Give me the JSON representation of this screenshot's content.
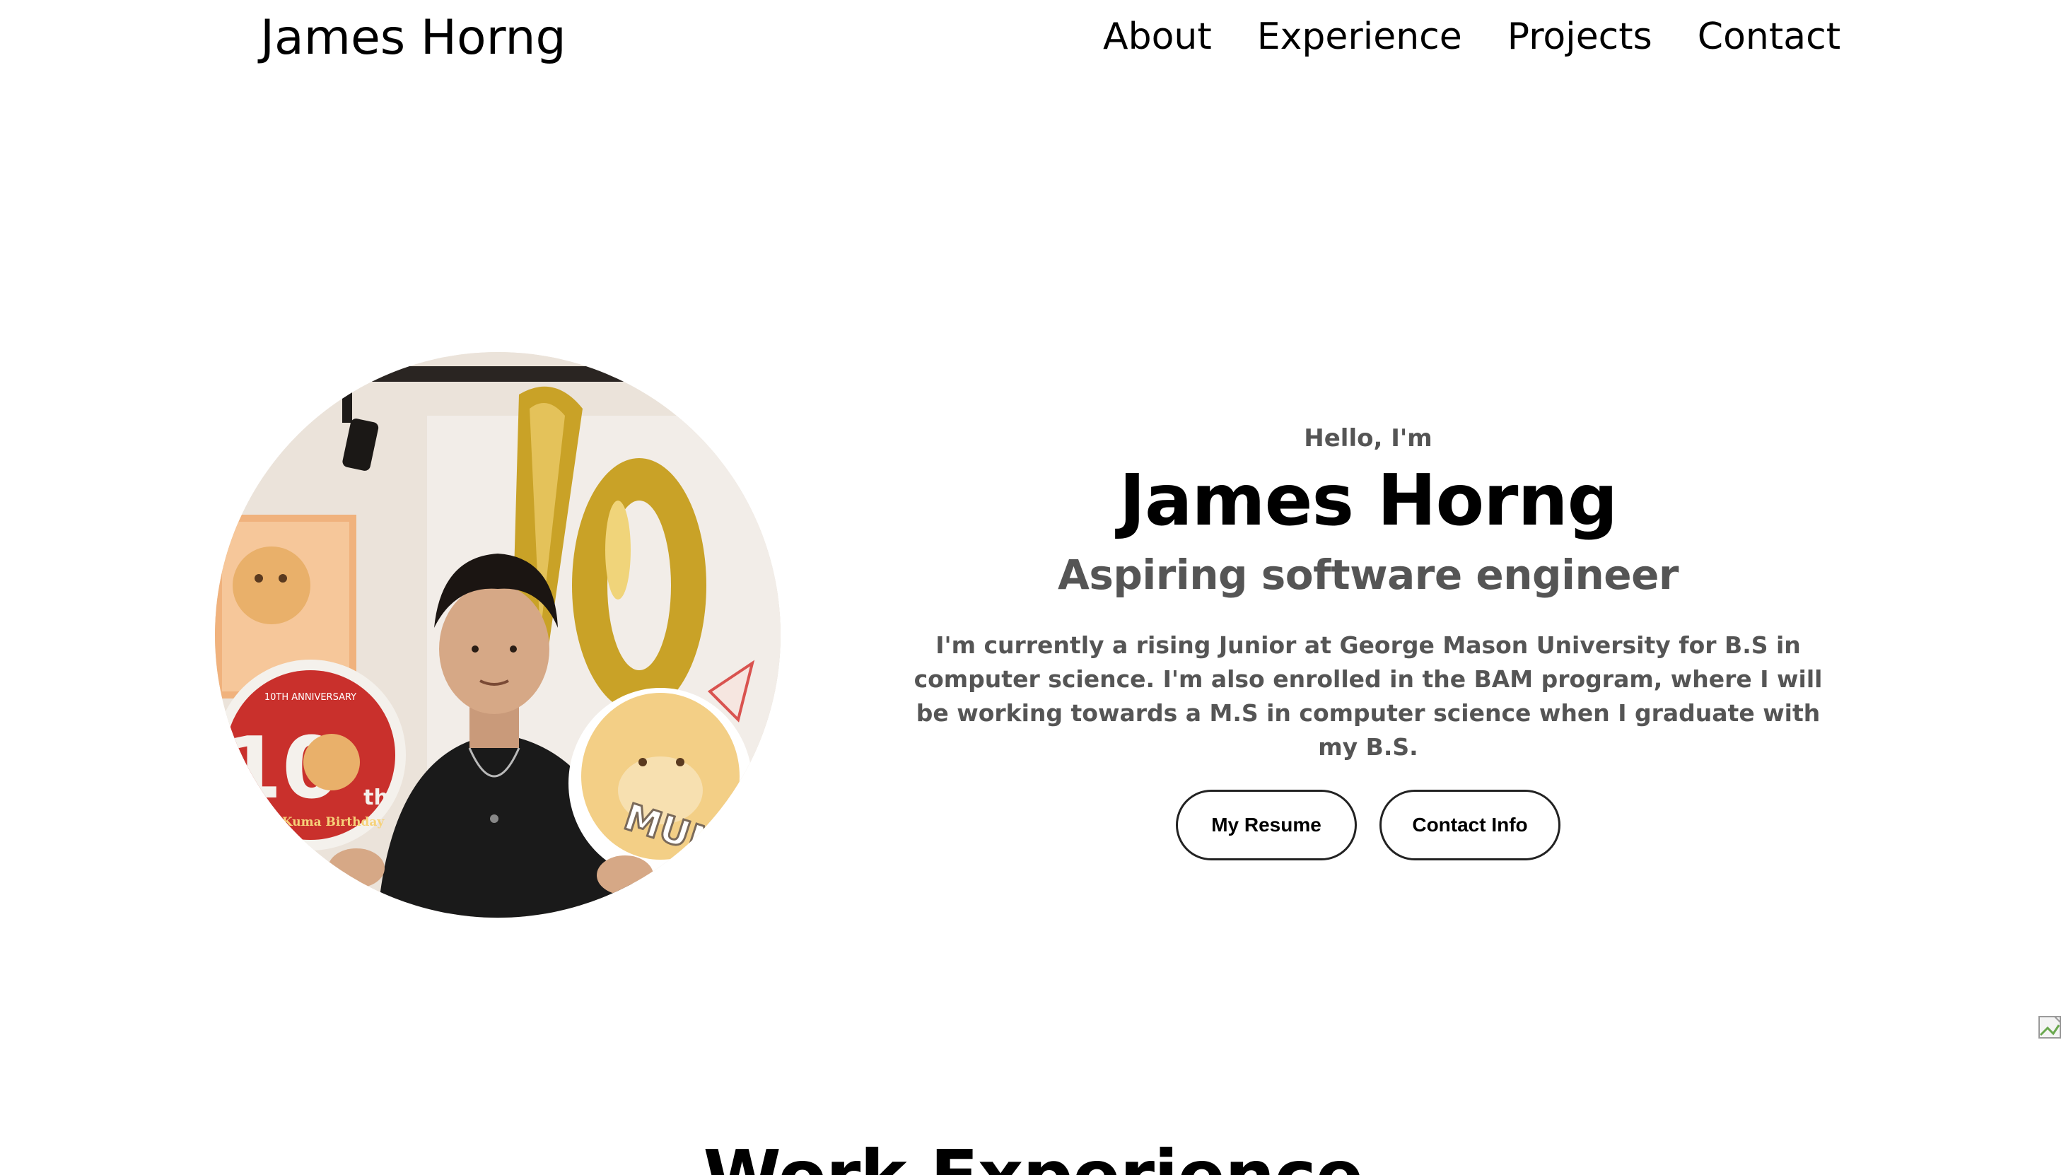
{
  "nav": {
    "logo": "James Horng",
    "links": [
      "About",
      "Experience",
      "Projects",
      "Contact"
    ]
  },
  "hero": {
    "greeting": "Hello, I'm",
    "name": "James Horng",
    "role": "Aspiring software engineer",
    "description": "I'm currently a rising Junior at George Mason University for B.S in computer science. I'm also enrolled in the BAM program, where I will be working towards a M.S in computer science when I graduate with my B.S.",
    "buttons": {
      "resume": "My Resume",
      "contact": "Contact Info"
    }
  },
  "photo_text": {
    "sign_text": "MUNA",
    "badge_number": "10",
    "badge_suffix": "th",
    "badge_caption": "Musai Kuma Birthday",
    "badge_ring_text": "10TH ANNIVERSARY"
  },
  "sections": {
    "work_title": "Work Experience"
  },
  "colors": {
    "text_primary": "#000000",
    "text_secondary": "#555555",
    "background": "#ffffff",
    "button_border": "#222222"
  }
}
